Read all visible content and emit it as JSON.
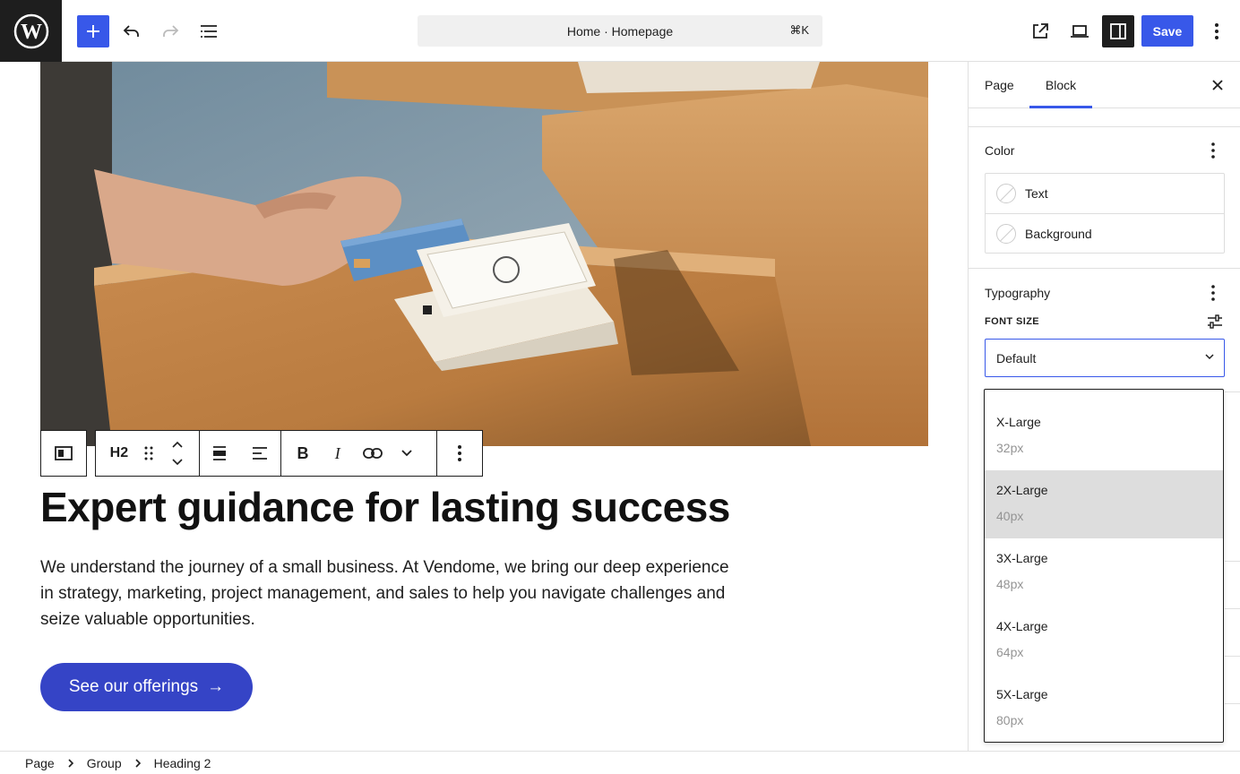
{
  "topbar": {
    "command_bar_text": "Home · Homepage",
    "command_shortcut": "⌘K",
    "save_label": "Save",
    "accent_color": "#3858e9"
  },
  "canvas": {
    "heading": "Expert guidance for lasting success",
    "paragraph": "We understand the journey of a small business. At Vendome, we bring our deep experience in strategy, marketing, project management, and sales to help you navigate challenges and seize valuable opportunities.",
    "cta_label": "See our offerings",
    "cta_arrow": "→",
    "cta_color": "#3544c6",
    "block_toolbar": {
      "heading_level": "H2"
    }
  },
  "sidebar": {
    "tabs": [
      {
        "label": "Page"
      },
      {
        "label": "Block"
      }
    ],
    "active_tab": "Block",
    "color_panel": {
      "title": "Color",
      "items": [
        {
          "label": "Text"
        },
        {
          "label": "Background"
        }
      ]
    },
    "typography_panel": {
      "title": "Typography",
      "font_size_label": "FONT SIZE",
      "selected_value": "Default",
      "options": [
        {
          "name": "X-Large",
          "size": "32px"
        },
        {
          "name": "2X-Large",
          "size": "40px"
        },
        {
          "name": "3X-Large",
          "size": "48px"
        },
        {
          "name": "4X-Large",
          "size": "64px"
        },
        {
          "name": "5X-Large",
          "size": "80px"
        }
      ],
      "highlighted_option": "2X-Large"
    }
  },
  "footer": {
    "breadcrumb": [
      "Page",
      "Group",
      "Heading 2"
    ]
  },
  "icons": [
    "wordpress-logo-icon",
    "plus-icon",
    "undo-icon",
    "redo-icon",
    "list-view-icon",
    "external-link-icon",
    "desktop-preview-icon",
    "sidebar-toggle-icon",
    "kebab-menu-icon",
    "close-icon",
    "sliders-icon",
    "chevron-down-icon",
    "chevron-right-icon",
    "bold-icon",
    "italic-icon",
    "link-icon",
    "drag-handle-icon",
    "align-icon",
    "text-align-icon"
  ]
}
